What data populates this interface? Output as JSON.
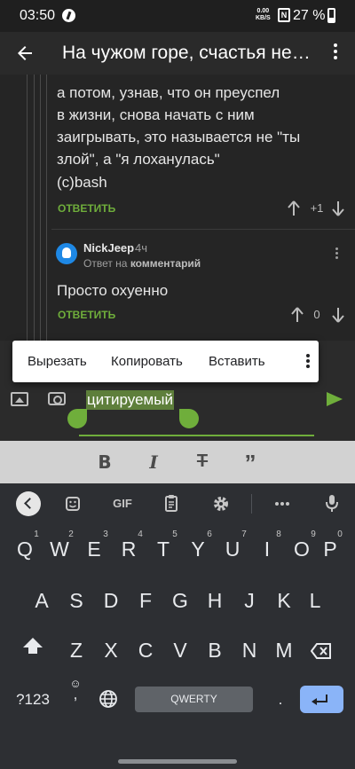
{
  "status_bar": {
    "time": "03:50",
    "net_speed_value": "0.00",
    "net_speed_unit": "KB/S",
    "battery": "27 %"
  },
  "app_bar": {
    "title": "На чужом горе, счастья не построишь"
  },
  "comments": [
    {
      "lines": [
        "а потом, узнав, что он преуспел",
        "в жизни, снова начать с ним",
        "заигрывать, это называется не \"ты",
        "злой\", а \"я лоханулась\"",
        "(c)bash"
      ],
      "reply_label": "ОТВЕТИТЬ",
      "votes": "+1"
    },
    {
      "author": "NickJeep",
      "time": "4ч",
      "reply_to_prefix": "Ответ на",
      "reply_to_target": "комментарий",
      "text": "Просто охуенно",
      "reply_label": "ОТВЕТИТЬ",
      "votes": "0"
    }
  ],
  "context_menu": {
    "items": [
      "Вырезать",
      "Копировать",
      "Вставить"
    ]
  },
  "composer": {
    "value": "цитируемый"
  },
  "keyboard": {
    "tools": {
      "gif_label": "GIF"
    },
    "row1": [
      "Q",
      "W",
      "E",
      "R",
      "T",
      "Y",
      "U",
      "I",
      "O",
      "P"
    ],
    "row1_hints": [
      "1",
      "2",
      "3",
      "4",
      "5",
      "6",
      "7",
      "8",
      "9",
      "0"
    ],
    "row2": [
      "A",
      "S",
      "D",
      "F",
      "G",
      "H",
      "J",
      "K",
      "L"
    ],
    "row3": [
      "Z",
      "X",
      "C",
      "V",
      "B",
      "N",
      "M"
    ],
    "symbols_label": "?123",
    "comma": ",",
    "period": ".",
    "space_label": "QWERTY"
  },
  "colors": {
    "accent": "#6fae3b",
    "enter_key": "#8ab4f8",
    "avatar": "#1e88e5"
  }
}
